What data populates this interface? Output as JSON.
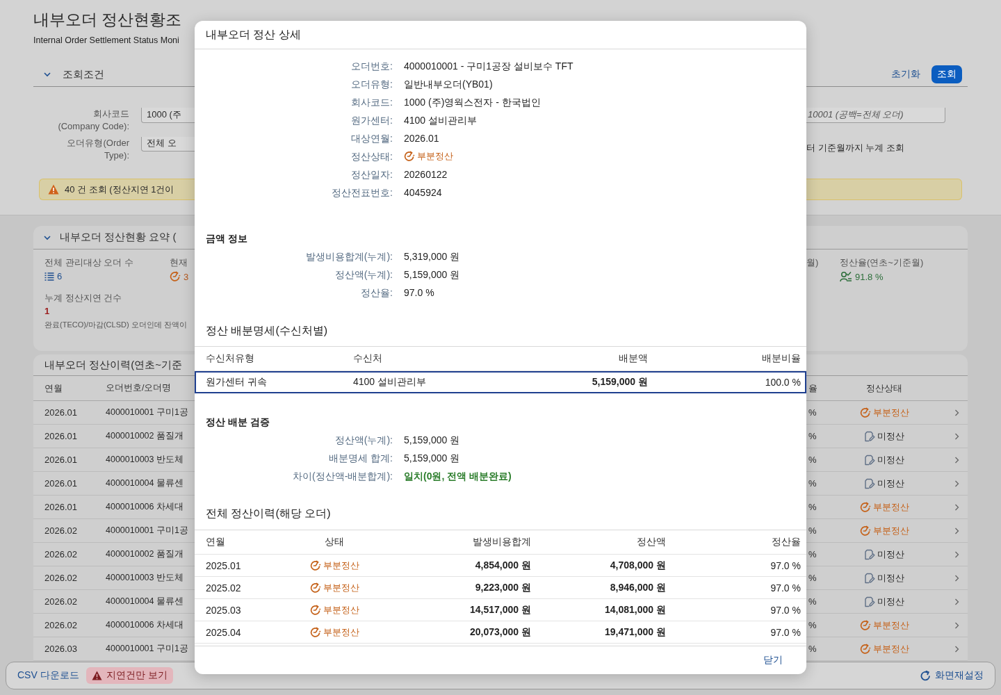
{
  "page": {
    "title": "내부오더 정산현황조",
    "subtitle": "Internal Order Settlement Status Moni"
  },
  "filter": {
    "header": "조회조건",
    "expanded": true,
    "reset_button": "초기화",
    "search_button": "조회",
    "fields": [
      {
        "label": "회사코드 (Company Code):",
        "value": "1000 (주"
      },
      {
        "label": "오더유형(Order Type):",
        "value": "전체 오"
      }
    ],
    "order_field": {
      "placeholder": "10001 (공백=전체 오더)"
    },
    "period_note": "터 기준월까지 누계 조회"
  },
  "message_strip": {
    "kind": "warning",
    "text": "40 건 조회 (정산지연 1건이"
  },
  "summary": {
    "header": "내부오더 정산현황 요약 (",
    "expanded": true,
    "left_kpis": [
      {
        "kind": "count",
        "label": "전체 관리대상 오더 수",
        "value": "6"
      },
      {
        "kind": "partial",
        "label": "현재",
        "value": "3"
      }
    ],
    "right_fragment": "월)",
    "right_kpis": [
      {
        "kind": "rate",
        "label": "정산율(연초~기준월)",
        "value": "91.8 %"
      }
    ],
    "delay": {
      "label": "누계 정산지연 건수",
      "value": "1",
      "note": "완료(TECO)/마감(CLSD) 오더인데 잔액이"
    }
  },
  "history": {
    "title": "내부오더 정산이력(연초~기준",
    "columns_left": [
      "연월",
      "오더번호/오더명"
    ],
    "columns_right": [
      "율",
      "정산상태"
    ],
    "rows": [
      {
        "month": "2026.01",
        "order": "4000010001 구미1공",
        "rate": "%",
        "status": {
          "kind": "partial",
          "label": "부분정산"
        }
      },
      {
        "month": "2026.01",
        "order": "4000010002 품질개",
        "rate": "%",
        "status": {
          "kind": "unsettled",
          "label": "미정산"
        }
      },
      {
        "month": "2026.01",
        "order": "4000010003 반도체",
        "rate": "%",
        "status": {
          "kind": "unsettled",
          "label": "미정산"
        }
      },
      {
        "month": "2026.01",
        "order": "4000010004 물류센",
        "rate": "%",
        "status": {
          "kind": "unsettled",
          "label": "미정산"
        }
      },
      {
        "month": "2026.01",
        "order": "4000010006 차세대",
        "rate": "%",
        "status": {
          "kind": "partial",
          "label": "부분정산"
        }
      },
      {
        "month": "2026.02",
        "order": "4000010001 구미1공",
        "rate": "%",
        "status": {
          "kind": "partial",
          "label": "부분정산"
        }
      },
      {
        "month": "2026.02",
        "order": "4000010002 품질개",
        "rate": "%",
        "status": {
          "kind": "unsettled",
          "label": "미정산"
        }
      },
      {
        "month": "2026.02",
        "order": "4000010003 반도체",
        "rate": "%",
        "status": {
          "kind": "unsettled",
          "label": "미정산"
        }
      },
      {
        "month": "2026.02",
        "order": "4000010004 물류센",
        "rate": "%",
        "status": {
          "kind": "unsettled",
          "label": "미정산"
        }
      },
      {
        "month": "2026.02",
        "order": "4000010006 차세대",
        "rate": "%",
        "status": {
          "kind": "partial",
          "label": "부분정산"
        }
      },
      {
        "month": "2026.03",
        "order": "4000010001 구미1공",
        "rate": "%",
        "status": {
          "kind": "partial",
          "label": "부분정산"
        }
      }
    ]
  },
  "footer": {
    "csv_button": "CSV 다운로드",
    "delay_button": "지연건만 보기",
    "reset_layout_button": "화면재설정"
  },
  "dialog": {
    "title": "내부오더 정산 상세",
    "fields": [
      {
        "kind": "text",
        "label": "오더번호:",
        "value": "4000010001 - 구미1공장 설비보수 TFT"
      },
      {
        "kind": "text",
        "label": "오더유형:",
        "value": "일반내부오더(YB01)"
      },
      {
        "kind": "text",
        "label": "회사코드:",
        "value": "1000 (주)영웍스전자 - 한국법인"
      },
      {
        "kind": "text",
        "label": "원가센터:",
        "value": "4100 설비관리부"
      },
      {
        "kind": "text",
        "label": "대상연월:",
        "value": "2026.01"
      },
      {
        "kind": "partial",
        "label": "정산상태:",
        "value": "부분정산"
      },
      {
        "kind": "text",
        "label": "정산일자:",
        "value": "20260122"
      },
      {
        "kind": "text",
        "label": "정산전표번호:",
        "value": "4045924"
      }
    ],
    "amount_section": {
      "title": "금액 정보",
      "fields": [
        {
          "kind": "text",
          "label": "발생비용합계(누계):",
          "value": "5,319,000 원"
        },
        {
          "kind": "text",
          "label": "정산액(누계):",
          "value": "5,159,000 원"
        },
        {
          "kind": "text",
          "label": "정산율:",
          "value": "97.0 %"
        }
      ]
    },
    "allocation": {
      "title": "정산 배분명세(수신처별)",
      "columns": [
        "수신처유형",
        "수신처",
        "배분액",
        "배분비율"
      ],
      "rows": [
        {
          "selected": true,
          "cells": [
            "원가센터 귀속",
            "4100 설비관리부",
            "5,159,000 원",
            "100.0 %"
          ]
        }
      ]
    },
    "check_section": {
      "title": "정산 배분 검증",
      "fields": [
        {
          "kind": "text",
          "label": "정산액(누계):",
          "value": "5,159,000 원"
        },
        {
          "kind": "text",
          "label": "배분명세 합계:",
          "value": "5,159,000 원"
        },
        {
          "kind": "success",
          "label": "차이(정산액-배분합계):",
          "value": "일치(0원, 전액 배분완료)"
        }
      ]
    },
    "order_history": {
      "title": "전체 정산이력(해당 오더)",
      "columns": [
        "연월",
        "상태",
        "발생비용합계",
        "정산액",
        "정산율"
      ],
      "rows": [
        {
          "month": "2025.01",
          "status": {
            "kind": "partial",
            "label": "부분정산"
          },
          "cost": "4,854,000 원",
          "settled": "4,708,000 원",
          "rate": "97.0 %"
        },
        {
          "month": "2025.02",
          "status": {
            "kind": "partial",
            "label": "부분정산"
          },
          "cost": "9,223,000 원",
          "settled": "8,946,000 원",
          "rate": "97.0 %"
        },
        {
          "month": "2025.03",
          "status": {
            "kind": "partial",
            "label": "부분정산"
          },
          "cost": "14,517,000 원",
          "settled": "14,081,000 원",
          "rate": "97.0 %"
        },
        {
          "month": "2025.04",
          "status": {
            "kind": "partial",
            "label": "부분정산"
          },
          "cost": "20,073,000 원",
          "settled": "19,471,000 원",
          "rate": "97.0 %"
        }
      ]
    },
    "close_button": "닫기"
  }
}
